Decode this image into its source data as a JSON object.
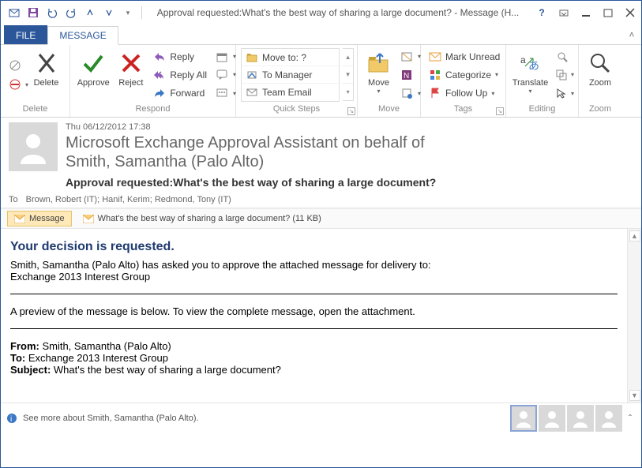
{
  "window": {
    "title": "Approval requested:What's the best way of sharing a large document? - Message (H..."
  },
  "tabs": {
    "file": "FILE",
    "message": "MESSAGE"
  },
  "ribbon": {
    "delete": {
      "ignore": "",
      "junk": "",
      "delete": "Delete",
      "group": "Delete"
    },
    "respond": {
      "approve": "Approve",
      "reject": "Reject",
      "reply": "Reply",
      "replyall": "Reply All",
      "forward": "Forward",
      "group": "Respond"
    },
    "quicksteps": {
      "moveto": "Move to: ?",
      "tomanager": "To Manager",
      "teamemail": "Team Email",
      "group": "Quick Steps"
    },
    "move": {
      "move": "Move",
      "rules": "",
      "onenote": "",
      "actions": "",
      "group": "Move"
    },
    "tags": {
      "unread": "Mark Unread",
      "categorize": "Categorize",
      "followup": "Follow Up",
      "group": "Tags"
    },
    "editing": {
      "translate": "Translate",
      "find": "",
      "related": "",
      "select": "",
      "group": "Editing"
    },
    "zoom": {
      "zoom": "Zoom",
      "group": "Zoom"
    }
  },
  "header": {
    "date": "Thu 06/12/2012 17:38",
    "from1": "Microsoft Exchange Approval Assistant on behalf of",
    "from2": "Smith, Samantha (Palo Alto)",
    "subject": "Approval requested:What's the best way of sharing a large document?",
    "to_label": "To",
    "to": "Brown, Robert (IT); Hanif, Kerim; Redmond, Tony (IT)"
  },
  "attachments": {
    "tab_message": "Message",
    "tab_attach": "What's the best way of sharing a large document? (11 KB)"
  },
  "body": {
    "heading": "Your decision is requested.",
    "line1": "Smith, Samantha (Palo Alto) has asked you to approve the attached message for delivery to:",
    "line2": "Exchange 2013 Interest Group",
    "preview": "A preview of the message is below. To view the complete message, open the attachment.",
    "from_lbl": "From:",
    "from_val": " Smith, Samantha (Palo Alto)",
    "to_lbl": "To:",
    "to_val": " Exchange 2013 Interest Group",
    "subj_lbl": "Subject:",
    "subj_val": " What's the best way of sharing a large document?"
  },
  "footer": {
    "text": "See more about Smith, Samantha (Palo Alto)."
  }
}
